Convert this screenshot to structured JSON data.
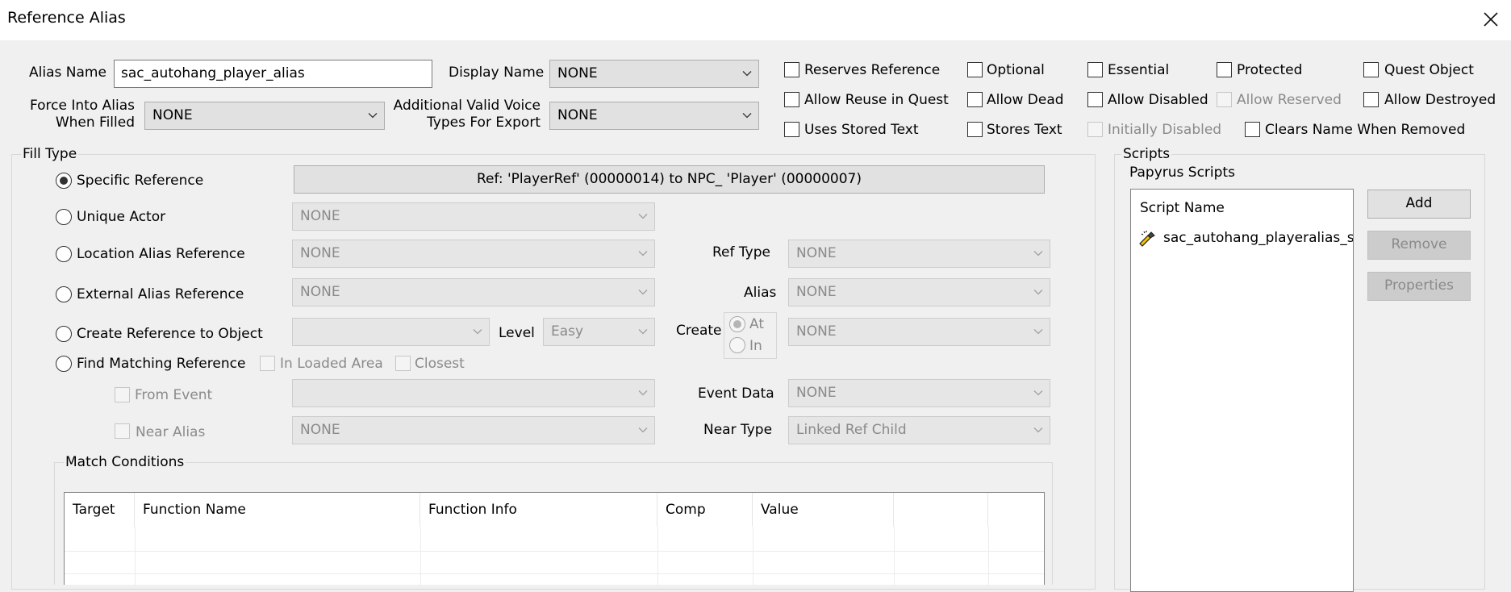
{
  "window": {
    "title": "Reference Alias"
  },
  "alias": {
    "name_label": "Alias Name",
    "name_value": "sac_autohang_player_alias",
    "display_name_label": "Display Name",
    "display_name_value": "NONE",
    "force_label_1": "Force Into Alias",
    "force_label_2": "When Filled",
    "force_value": "NONE",
    "voice_label_1": "Additional Valid Voice",
    "voice_label_2": "Types For Export",
    "voice_value": "NONE"
  },
  "flags": {
    "reserves_reference": "Reserves Reference",
    "optional": "Optional",
    "essential": "Essential",
    "protected": "Protected",
    "quest_object": "Quest Object",
    "allow_reuse": "Allow Reuse in Quest",
    "allow_dead": "Allow Dead",
    "allow_disabled": "Allow Disabled",
    "allow_reserved": "Allow Reserved",
    "allow_destroyed": "Allow Destroyed",
    "uses_stored_text": "Uses Stored Text",
    "stores_text": "Stores Text",
    "initially_disabled": "Initially Disabled",
    "clears_name": "Clears Name When Removed"
  },
  "fill": {
    "group_label": "Fill Type",
    "specific_reference": "Specific Reference",
    "specific_reference_value": "Ref: 'PlayerRef' (00000014) to NPC_ 'Player' (00000007)",
    "unique_actor": "Unique Actor",
    "unique_actor_value": "NONE",
    "location_alias": "Location Alias Reference",
    "location_alias_value": "NONE",
    "ref_type_label": "Ref Type",
    "ref_type_value": "NONE",
    "external_alias": "External Alias Reference",
    "external_alias_value": "NONE",
    "alias_label": "Alias",
    "alias_value": "NONE",
    "create_reference": "Create Reference to Object",
    "create_reference_value": "",
    "level_label": "Level",
    "level_value": "Easy",
    "create_label": "Create",
    "at_label": "At",
    "in_label": "In",
    "create_value": "NONE",
    "find_matching": "Find Matching Reference",
    "in_loaded_area": "In Loaded Area",
    "closest": "Closest",
    "from_event": "From Event",
    "from_event_value": "",
    "event_data_label": "Event Data",
    "event_data_value": "NONE",
    "near_alias": "Near Alias",
    "near_alias_value": "NONE",
    "near_type_label": "Near Type",
    "near_type_value": "Linked Ref Child"
  },
  "conditions": {
    "group_label": "Match Conditions",
    "columns": [
      "Target",
      "Function Name",
      "Function Info",
      "Comp",
      "Value"
    ]
  },
  "scripts": {
    "group_label": "Scripts",
    "sub_label": "Papyrus Scripts",
    "column": "Script Name",
    "items": [
      "sac_autohang_playeralias_s"
    ],
    "add": "Add",
    "remove": "Remove",
    "properties": "Properties"
  }
}
